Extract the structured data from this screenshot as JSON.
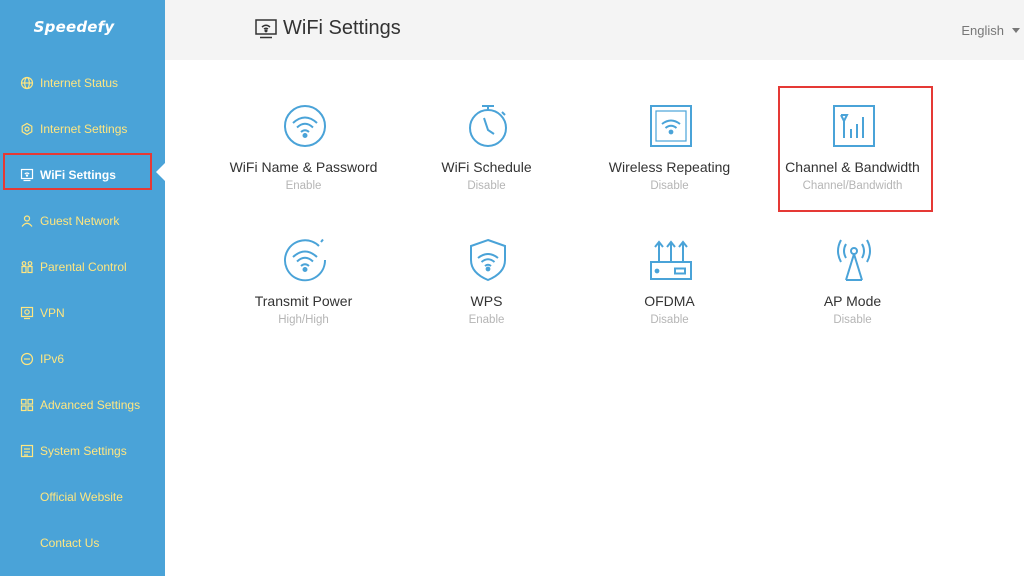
{
  "brand": "Speedefy",
  "sidebar": {
    "items": [
      {
        "label": "Internet Status"
      },
      {
        "label": "Internet Settings"
      },
      {
        "label": "WiFi Settings"
      },
      {
        "label": "Guest Network"
      },
      {
        "label": "Parental Control"
      },
      {
        "label": "VPN"
      },
      {
        "label": "IPv6"
      },
      {
        "label": "Advanced Settings"
      },
      {
        "label": "System Settings"
      },
      {
        "label": "Official Website"
      },
      {
        "label": "Contact Us"
      }
    ],
    "active_index": 2
  },
  "header": {
    "title": "WiFi Settings",
    "language": "English"
  },
  "tiles": [
    {
      "title": "WiFi Name & Password",
      "status": "Enable",
      "icon": "wifi-circle-icon"
    },
    {
      "title": "WiFi Schedule",
      "status": "Disable",
      "icon": "stopwatch-icon"
    },
    {
      "title": "Wireless Repeating",
      "status": "Disable",
      "icon": "wifi-square-icon"
    },
    {
      "title": "Channel & Bandwidth",
      "status": "Channel/Bandwidth",
      "icon": "antenna-bars-icon"
    },
    {
      "title": "Transmit Power",
      "status": "High/High",
      "icon": "wifi-power-icon"
    },
    {
      "title": "WPS",
      "status": "Enable",
      "icon": "wifi-shield-icon"
    },
    {
      "title": "OFDMA",
      "status": "Disable",
      "icon": "router-icon"
    },
    {
      "title": "AP Mode",
      "status": "Disable",
      "icon": "broadcast-tower-icon"
    }
  ],
  "colors": {
    "sidebar_bg": "#4aa3d8",
    "nav_text": "#ffe680",
    "icon_stroke": "#4aa3d8",
    "highlight": "#e53935"
  }
}
